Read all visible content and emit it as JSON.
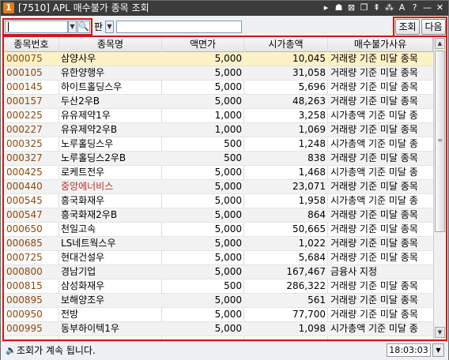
{
  "window": {
    "badge": "1",
    "title": "[7510] APL 매수불가 종목 조회",
    "title_icons": [
      "▸",
      "☗",
      "⊠",
      "❐",
      "⇞",
      "⁂",
      "A",
      "?",
      "—",
      "✕"
    ]
  },
  "toolbar": {
    "code_value": "",
    "market_label": "판",
    "name_value": "",
    "query_label": "조회",
    "next_label": "다음"
  },
  "columns": [
    "종목번호",
    "종목명",
    "액면가",
    "시가총액",
    "매수불가사유"
  ],
  "rows": [
    {
      "code": "000075",
      "name": "삼양사우",
      "par": "5,000",
      "cap": "10,045",
      "reason": "거래량 기준 미달 종목"
    },
    {
      "code": "000105",
      "name": "유한양행우",
      "par": "5,000",
      "cap": "31,058",
      "reason": "거래량 기준 미달 종목"
    },
    {
      "code": "000145",
      "name": "하이트홀딩스우",
      "par": "5,000",
      "cap": "5,696",
      "reason": "거래량 기준 미달 종목"
    },
    {
      "code": "000157",
      "name": "두산2우B",
      "par": "5,000",
      "cap": "48,263",
      "reason": "거래량 기준 미달 종목"
    },
    {
      "code": "000225",
      "name": "유유제약1우",
      "par": "1,000",
      "cap": "3,258",
      "reason": "시가총액 기준 미달 종"
    },
    {
      "code": "000227",
      "name": "유유제약2우B",
      "par": "1,000",
      "cap": "1,069",
      "reason": "거래량 기준 미달 종목"
    },
    {
      "code": "000325",
      "name": "노루홀딩스우",
      "par": "500",
      "cap": "1,248",
      "reason": "시가총액 기준 미달 종"
    },
    {
      "code": "000327",
      "name": "노루홀딩스2우B",
      "par": "500",
      "cap": "838",
      "reason": "거래량 기준 미달 종목"
    },
    {
      "code": "000425",
      "name": "로케트전우",
      "par": "5,000",
      "cap": "1,468",
      "reason": "시가총액 기준 미달 종"
    },
    {
      "code": "000440",
      "name": "중앙에너비스",
      "par": "5,000",
      "cap": "23,071",
      "reason": "거래량 기준 미달 종목"
    },
    {
      "code": "000545",
      "name": "흥국화재우",
      "par": "5,000",
      "cap": "1,958",
      "reason": "시가총액 기준 미달 종"
    },
    {
      "code": "000547",
      "name": "흥국화재2우B",
      "par": "5,000",
      "cap": "864",
      "reason": "거래량 기준 미달 종목"
    },
    {
      "code": "000650",
      "name": "천일고속",
      "par": "5,000",
      "cap": "50,665",
      "reason": "거래량 기준 미달 종목"
    },
    {
      "code": "000685",
      "name": "LS네트웍스우",
      "par": "5,000",
      "cap": "1,022",
      "reason": "거래량 기준 미달 종목"
    },
    {
      "code": "000725",
      "name": "현대건설우",
      "par": "5,000",
      "cap": "5,684",
      "reason": "거래량 기준 미달 종목"
    },
    {
      "code": "000800",
      "name": "경남기업",
      "par": "5,000",
      "cap": "167,467",
      "reason": "금융사 지정"
    },
    {
      "code": "000815",
      "name": "삼성화재우",
      "par": "500",
      "cap": "286,322",
      "reason": "거래량 기준 미달 종목"
    },
    {
      "code": "000895",
      "name": "보해양조우",
      "par": "5,000",
      "cap": "561",
      "reason": "거래량 기준 미달 종목"
    },
    {
      "code": "000950",
      "name": "전방",
      "par": "5,000",
      "cap": "77,700",
      "reason": "거래량 기준 미달 종목"
    },
    {
      "code": "000995",
      "name": "동부하이텍1우",
      "par": "5,000",
      "cap": "1,098",
      "reason": "시가총액 기준 미달 종"
    }
  ],
  "status": {
    "message": "조회가 계속 됩니다.",
    "time": "18:03:03"
  },
  "colors": {
    "highlight_border": "#d01818",
    "selected_row": "#fdf1c6",
    "code_text": "#8a4a12",
    "alert_name_text": "#b8322a"
  }
}
